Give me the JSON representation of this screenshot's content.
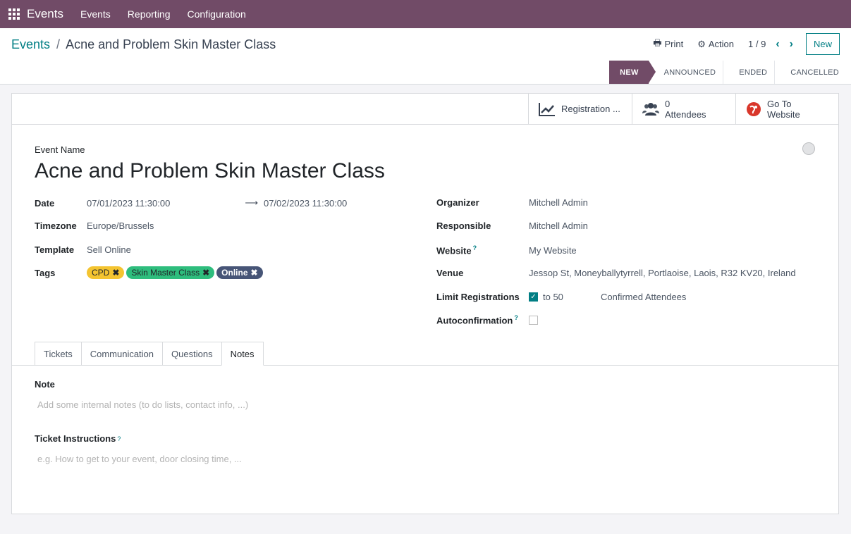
{
  "topbar": {
    "app": "Events",
    "menus": [
      "Events",
      "Reporting",
      "Configuration"
    ]
  },
  "breadcrumb": {
    "parent": "Events",
    "separator": "/",
    "current": "Acne and Problem Skin Master Class"
  },
  "toolbar": {
    "print": "Print",
    "action": "Action",
    "pager": "1 / 9",
    "new": "New"
  },
  "statusbar": [
    "NEW",
    "ANNOUNCED",
    "ENDED",
    "CANCELLED"
  ],
  "smart_buttons": {
    "registration": "Registration ...",
    "attendees_count": "0",
    "attendees_label": "Attendees",
    "website_line1": "Go To",
    "website_line2": "Website"
  },
  "form": {
    "event_name_label": "Event Name",
    "event_name": "Acne and Problem Skin Master Class",
    "date_label": "Date",
    "date_start": "07/01/2023 11:30:00",
    "date_end": "07/02/2023 11:30:00",
    "timezone_label": "Timezone",
    "timezone": "Europe/Brussels",
    "template_label": "Template",
    "template": "Sell Online",
    "tags_label": "Tags",
    "tags": [
      {
        "label": "CPD",
        "color": "#f4c430"
      },
      {
        "label": "Skin Master Class",
        "color": "#2ebd7d"
      },
      {
        "label": "Online",
        "color": "#475577"
      }
    ],
    "organizer_label": "Organizer",
    "organizer": "Mitchell Admin",
    "responsible_label": "Responsible",
    "responsible": "Mitchell Admin",
    "website_label": "Website",
    "website": "My Website",
    "venue_label": "Venue",
    "venue": "Jessop St, Moneyballytyrrell, Portlaoise, Laois, R32 KV20, Ireland",
    "limit_label": "Limit Registrations",
    "limit_checked": true,
    "limit_to": "to 50",
    "limit_suffix": "Confirmed Attendees",
    "autoconf_label": "Autoconfirmation",
    "autoconf_checked": false,
    "help": "?"
  },
  "tabs": [
    "Tickets",
    "Communication",
    "Questions",
    "Notes"
  ],
  "notes": {
    "note_label": "Note",
    "note_placeholder": "Add some internal notes (to do lists, contact info, ...)",
    "ticket_label": "Ticket Instructions",
    "ticket_placeholder": "e.g. How to get to your event, door closing time, ..."
  },
  "colors": {
    "brand": "#714b67",
    "accent": "#017e84"
  }
}
